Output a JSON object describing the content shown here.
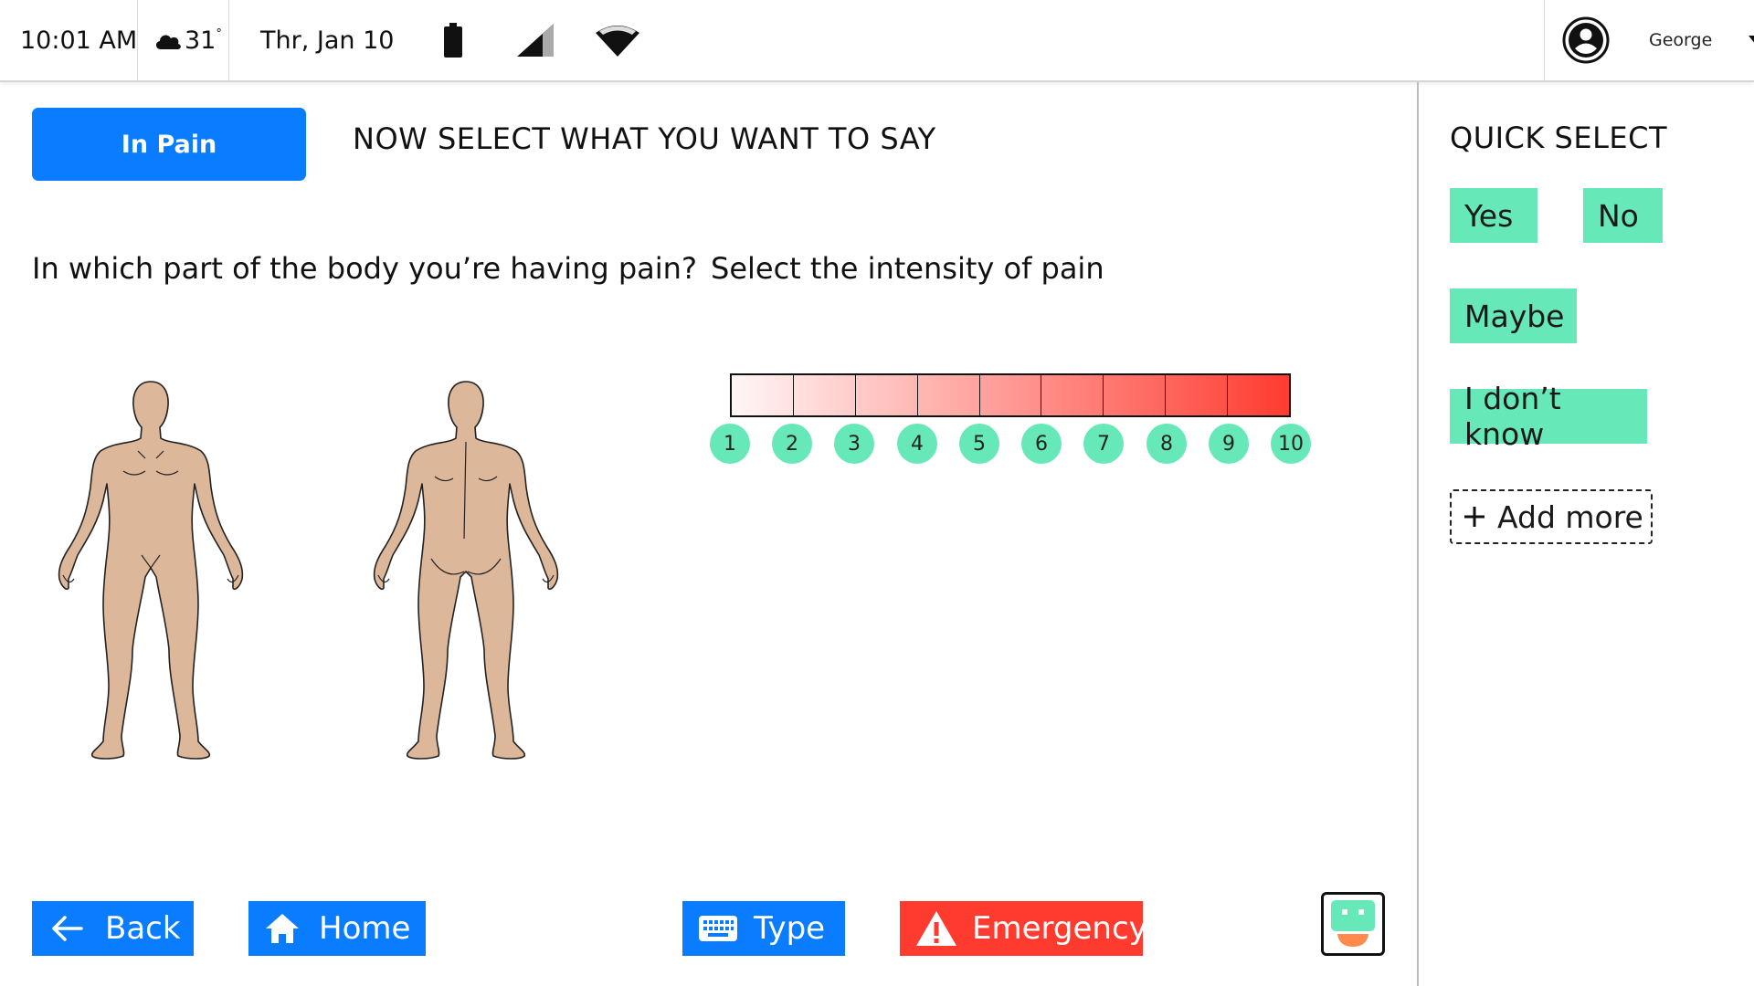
{
  "status_bar": {
    "time": "10:01 AM",
    "temperature": "31",
    "temperature_unit": "°",
    "weather_icon": "cloud-icon",
    "date": "Thr, Jan 10",
    "battery_icon": "battery-icon",
    "signal_icon": "cellular-signal-icon",
    "wifi_icon": "wifi-icon",
    "user": {
      "name": "George",
      "avatar_icon": "account-circle-icon",
      "menu_icon": "caret-down-icon"
    }
  },
  "main": {
    "category_button": "In Pain",
    "instruction": "NOW SELECT WHAT YOU WANT TO SAY",
    "body_question": "In which part of the body you’re having pain?",
    "intensity_question": "Select the intensity of pain",
    "body_figures": [
      "body-front-figure",
      "body-back-figure"
    ],
    "pain_scale": {
      "levels": [
        "1",
        "2",
        "3",
        "4",
        "5",
        "6",
        "7",
        "8",
        "9",
        "10"
      ],
      "color_start": "#fff6f6",
      "color_end": "#ff3b30",
      "level_color": "#67e8b9"
    }
  },
  "quick_select": {
    "title": "QUICK SELECT",
    "items": [
      "Yes",
      "No",
      "Maybe",
      "I don’t know"
    ],
    "add_more": "Add more"
  },
  "bottom_bar": {
    "back": "Back",
    "home": "Home",
    "type": "Type",
    "emergency": "Emergency"
  },
  "colors": {
    "primary": "#0a7cff",
    "emergency": "#ff3b30",
    "quick_select": "#67e8b9",
    "skin": "#ddb79a"
  }
}
